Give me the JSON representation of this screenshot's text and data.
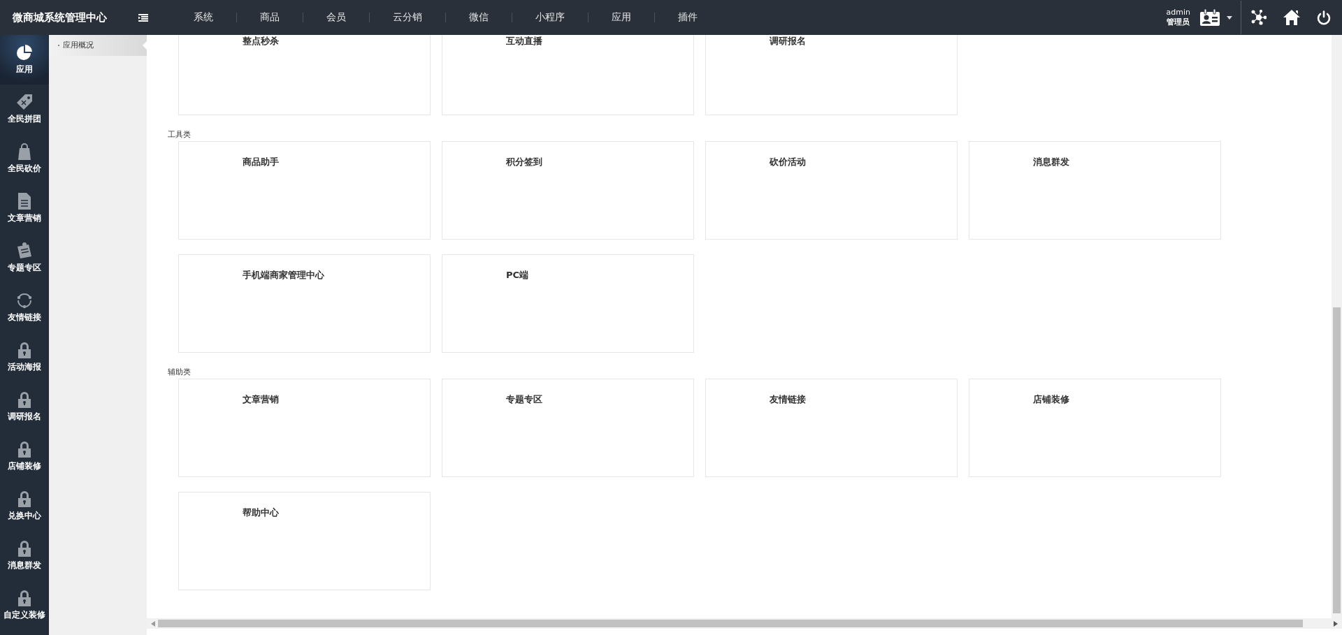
{
  "topbar": {
    "title": "微商城系统管理中心",
    "nav": [
      "系统",
      "商品",
      "会员",
      "云分销",
      "微信",
      "小程序",
      "应用",
      "插件"
    ],
    "user": {
      "name": "admin",
      "role": "管理员"
    }
  },
  "sidebar": {
    "items": [
      {
        "label": "应用",
        "selected": true,
        "locked": false
      },
      {
        "label": "全民拼团",
        "selected": false,
        "locked": false
      },
      {
        "label": "全民砍价",
        "selected": false,
        "locked": false
      },
      {
        "label": "文章营销",
        "selected": false,
        "locked": false
      },
      {
        "label": "专题专区",
        "selected": false,
        "locked": false
      },
      {
        "label": "友情链接",
        "selected": false,
        "locked": false
      },
      {
        "label": "活动海报",
        "selected": false,
        "locked": true
      },
      {
        "label": "调研报名",
        "selected": false,
        "locked": true
      },
      {
        "label": "店铺装修",
        "selected": false,
        "locked": true
      },
      {
        "label": "兑换中心",
        "selected": false,
        "locked": true
      },
      {
        "label": "消息群发",
        "selected": false,
        "locked": true
      },
      {
        "label": "自定义装修",
        "selected": false,
        "locked": true
      }
    ]
  },
  "submenu": {
    "items": [
      {
        "label": "应用概况",
        "selected": true
      }
    ]
  },
  "sections": [
    {
      "cards": [
        "整点秒杀",
        "互动直播",
        "调研报名"
      ]
    },
    {
      "title": "工具类",
      "cards": [
        "商品助手",
        "积分签到",
        "砍价活动",
        "消息群发",
        "手机端商家管理中心",
        "PC端"
      ]
    },
    {
      "title": "辅助类",
      "cards": [
        "文章营销",
        "专题专区",
        "友情链接",
        "店铺装修",
        "帮助中心"
      ]
    }
  ]
}
